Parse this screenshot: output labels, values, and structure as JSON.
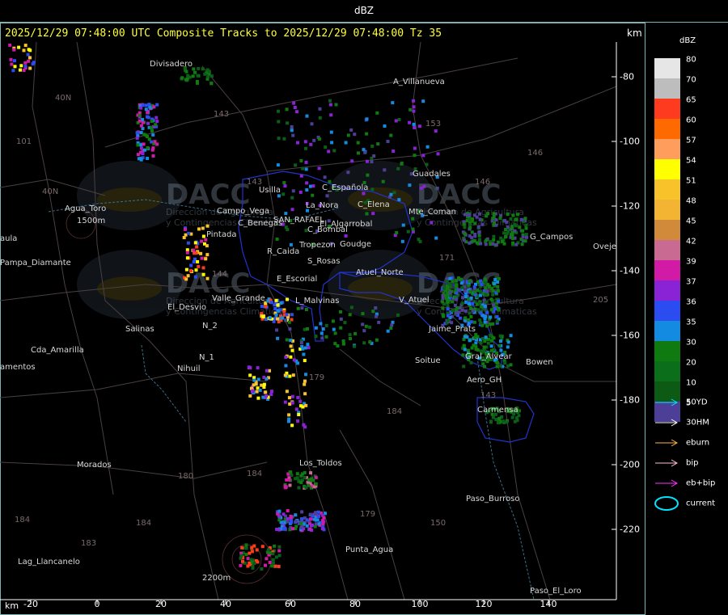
{
  "window": {
    "title": "dBZ"
  },
  "header": {
    "text": "2025/12/29 07:48:00 UTC Composite Tracks to 2025/12/29 07:48:00 Tz 35",
    "unit": "km"
  },
  "legend": {
    "title": "dBZ",
    "levels": [
      {
        "label": "80",
        "color": "#e6e6e6"
      },
      {
        "label": "70",
        "color": "#bdbdbd"
      },
      {
        "label": "65",
        "color": "#ff3b1f"
      },
      {
        "label": "60",
        "color": "#ff6a00"
      },
      {
        "label": "57",
        "color": "#ff9d5c"
      },
      {
        "label": "54",
        "color": "#ffff00"
      },
      {
        "label": "51",
        "color": "#f7c22a"
      },
      {
        "label": "48",
        "color": "#f3b333"
      },
      {
        "label": "45",
        "color": "#d08a3a"
      },
      {
        "label": "42",
        "color": "#c86a92"
      },
      {
        "label": "39",
        "color": "#d11aa6"
      },
      {
        "label": "37",
        "color": "#8a22d6"
      },
      {
        "label": "36",
        "color": "#2a4cf0"
      },
      {
        "label": "35",
        "color": "#138be0"
      },
      {
        "label": "30",
        "color": "#0f7a0f"
      },
      {
        "label": "20",
        "color": "#0b6e1a"
      },
      {
        "label": "10",
        "color": "#0d5a15"
      },
      {
        "label": "5",
        "color": "#4d3f98"
      }
    ],
    "tracks": [
      {
        "label": "50YD",
        "color": "#00e5ff"
      },
      {
        "label": "30HM",
        "color": "#ffffff"
      },
      {
        "label": "eburn",
        "color": "#ffb347"
      },
      {
        "label": "bip",
        "color": "#ffc0cb"
      },
      {
        "label": "eb+bip",
        "color": "#ff33ff"
      },
      {
        "label": "current",
        "color": "#00e5ff"
      }
    ]
  },
  "axes": {
    "x_unit": "km",
    "x_ticks": [
      "-20",
      "0",
      "20",
      "40",
      "60",
      "80",
      "100",
      "120",
      "140"
    ],
    "y_unit": "km",
    "y_ticks": [
      "-80",
      "-100",
      "-120",
      "-140",
      "-160",
      "-180",
      "-200",
      "-220"
    ]
  },
  "places": [
    {
      "name": "Divisadero"
    },
    {
      "name": "A_Villanueva"
    },
    {
      "name": "Guadales"
    },
    {
      "name": "Usilla"
    },
    {
      "name": "C_Espanola"
    },
    {
      "name": "La_Nora"
    },
    {
      "name": "C_Elena"
    },
    {
      "name": "Cuadro_Benegas"
    },
    {
      "name": "SAN_RAFAEL"
    },
    {
      "name": "El_Algarrobal"
    },
    {
      "name": "C_Bombal"
    },
    {
      "name": "Pintada"
    },
    {
      "name": "Tropezon"
    },
    {
      "name": "Goudge"
    },
    {
      "name": "R_Caida"
    },
    {
      "name": "S_Rosas"
    },
    {
      "name": "Atuel_Norte"
    },
    {
      "name": "E_Escorial"
    },
    {
      "name": "L_Malvinas"
    },
    {
      "name": "Valle_Grande"
    },
    {
      "name": "El_Desvio"
    },
    {
      "name": "V_Atuel"
    },
    {
      "name": "Salinas"
    },
    {
      "name": "N_2"
    },
    {
      "name": "N_1"
    },
    {
      "name": "Nihuil"
    },
    {
      "name": "Soitue"
    },
    {
      "name": "Aero_GH"
    },
    {
      "name": "G_Campos"
    },
    {
      "name": "Ovejero"
    },
    {
      "name": "Agua_Toro"
    },
    {
      "name": "Pampa_Diamante"
    },
    {
      "name": "Cda_Amarilla"
    },
    {
      "name": "Los_Toldos"
    },
    {
      "name": "Morados"
    },
    {
      "name": "Paso_Burroso"
    },
    {
      "name": "Punta_Agua"
    },
    {
      "name": "Lag_Llancanelo"
    },
    {
      "name": "Paso_El_Loro"
    },
    {
      "name": "Carmensa"
    },
    {
      "name": "Bowen"
    },
    {
      "name": "Monte_Coman"
    }
  ],
  "place_labels": {
    "Divisadero": "Divisadero",
    "A_Villanueva": "A_Villanueva",
    "Guadales": "Guadales",
    "Usilla": "Usilla",
    "C_Espanola": "C_Española",
    "La_Nora": "La_Nora",
    "C_Elena": "C_Elena",
    "Cuadro_Benegas": "C_Benegas",
    "SAN_RAFAEL": "SAN_RAFAEL",
    "El_Algarrobal": "El_Algarrobal",
    "C_Bombal": "C_Bombal",
    "Pintada": "Pintada",
    "Tropezon": "Tropezon",
    "Goudge": "Goudge",
    "R_Caida": "R_Caida",
    "S_Rosas": "S_Rosas",
    "Atuel_Norte": "Atuel_Norte",
    "E_Escorial": "E_Escorial",
    "L_Malvinas": "L_Malvinas",
    "Valle_Grande": "Valle_Grande",
    "El_Desvio": "El_Desvio",
    "V_Atuel": "V_Atuel",
    "Salinas": "Salinas",
    "N_2": "N_2",
    "N_1": "N_1",
    "Nihuil": "Nihuil",
    "Soitue": "Soitue",
    "Aero_GH": "Aero_GH",
    "G_Campos": "G_Campos",
    "Ovejero": "Ovejeros",
    "Agua_Toro": "Agua_Toro",
    "Pampa_Diamante": "Pampa_Diamante",
    "Cda_Amarilla": "Cda_Amarilla",
    "Los_Toldos": "Los_Toldos",
    "Morados": "Morados",
    "Paso_Burroso": "Paso_Burroso",
    "Punta_Agua": "Punta_Agua",
    "Lag_Llancanelo": "Lag_Llancanelo",
    "Paso_El_Loro": "Paso_El_Loro",
    "Carmensa": "Carmensa",
    "Bowen": "Bowen",
    "Monte_Coman": "Mte_Coman"
  },
  "extra_labels": [
    "Campo_Vega",
    "Jaime_Prats",
    "Gral_Alvear",
    "amentos",
    "aula",
    "1500m",
    "2200m"
  ],
  "road_numbers": [
    "40N",
    "40N",
    "101",
    "143",
    "153",
    "146",
    "143",
    "146",
    "171",
    "144",
    "184",
    "179",
    "184",
    "180",
    "184",
    "179",
    "150",
    "183",
    "184",
    "205",
    "143"
  ],
  "watermark": {
    "brand": "DACC",
    "subtitle_1": "Direccion de Agricultura",
    "subtitle_2": "y Contingencias Climaticas"
  }
}
